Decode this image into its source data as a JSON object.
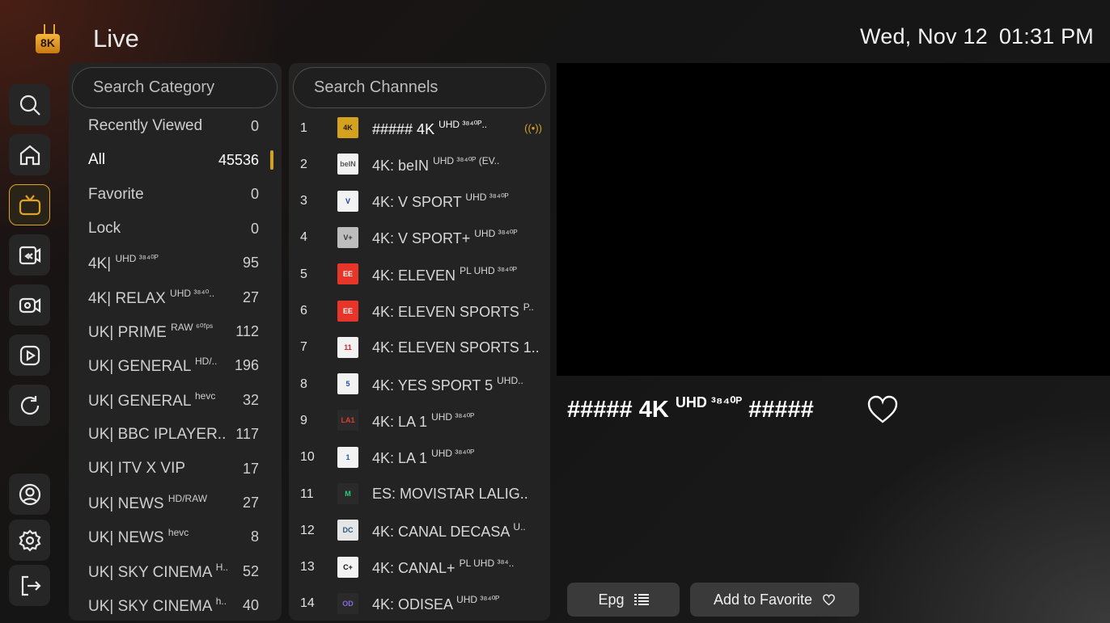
{
  "header": {
    "logo_text": "8K",
    "page_title": "Live",
    "date": "Wed, Nov 12",
    "time": "01:31 PM"
  },
  "rail": [
    {
      "icon": "search-icon"
    },
    {
      "icon": "home-icon"
    },
    {
      "icon": "tv-icon",
      "active": true
    },
    {
      "icon": "catchup-icon"
    },
    {
      "icon": "movies-icon"
    },
    {
      "icon": "series-icon"
    },
    {
      "icon": "refresh-icon"
    },
    {
      "icon": "account-icon"
    },
    {
      "icon": "settings-icon"
    },
    {
      "icon": "logout-icon"
    }
  ],
  "categories": {
    "search_placeholder": "Search Category",
    "items": [
      {
        "label": "Recently Viewed",
        "count": "0"
      },
      {
        "label": "All",
        "count": "45536",
        "selected": true
      },
      {
        "label": "Favorite",
        "count": "0"
      },
      {
        "label": "Lock",
        "count": "0"
      },
      {
        "label": "4K|",
        "sup": "UHD ³⁸⁴⁰ᴾ",
        "count": "95"
      },
      {
        "label": "4K| RELAX",
        "sup": "UHD ³⁸⁴⁰..",
        "count": "27"
      },
      {
        "label": "UK| PRIME",
        "sup": "RAW ⁶⁰ᶠᵖˢ",
        "count": "112"
      },
      {
        "label": "UK| GENERAL",
        "sup": "HD/..",
        "count": "196"
      },
      {
        "label": "UK| GENERAL",
        "sup": "hevc",
        "count": "32"
      },
      {
        "label": "UK| BBC IPLAYER..",
        "sup": "",
        "count": "117"
      },
      {
        "label": "UK| ITV X VIP",
        "sup": "",
        "count": "17"
      },
      {
        "label": "UK| NEWS",
        "sup": "HD/RAW",
        "count": "27"
      },
      {
        "label": "UK| NEWS",
        "sup": "hevc",
        "count": "8"
      },
      {
        "label": "UK| SKY CINEMA",
        "sup": "H..",
        "count": "52"
      },
      {
        "label": "UK| SKY CINEMA",
        "sup": "h..",
        "count": "40"
      }
    ]
  },
  "channels": {
    "search_placeholder": "Search Channels",
    "items": [
      {
        "num": "1",
        "name": "##### 4K",
        "sup": "UHD ³⁸⁴⁰ᴾ..",
        "logo": "4K",
        "playing": true
      },
      {
        "num": "2",
        "name": "4K: beIN",
        "sup": "UHD ³⁸⁴⁰ᴾ (EV..",
        "logo": "beIN"
      },
      {
        "num": "3",
        "name": "4K: V SPORT",
        "sup": "UHD ³⁸⁴⁰ᴾ",
        "logo": "V"
      },
      {
        "num": "4",
        "name": "4K: V SPORT+",
        "sup": "UHD ³⁸⁴⁰ᴾ",
        "logo": "V+"
      },
      {
        "num": "5",
        "name": "4K: ELEVEN",
        "sup": "PL UHD ³⁸⁴⁰ᴾ",
        "logo": "EE"
      },
      {
        "num": "6",
        "name": "4K: ELEVEN SPORTS",
        "sup": "P..",
        "logo": "EE"
      },
      {
        "num": "7",
        "name": "4K: ELEVEN SPORTS 1..",
        "sup": "",
        "logo": "11"
      },
      {
        "num": "8",
        "name": "4K: YES SPORT 5",
        "sup": "UHD..",
        "logo": "5"
      },
      {
        "num": "9",
        "name": "4K: LA 1",
        "sup": "UHD ³⁸⁴⁰ᴾ",
        "logo": "LA1"
      },
      {
        "num": "10",
        "name": "4K: LA 1",
        "sup": "UHD ³⁸⁴⁰ᴾ",
        "logo": "1"
      },
      {
        "num": "11",
        "name": "ES: MOVISTAR  LALIG..",
        "sup": "",
        "logo": "M"
      },
      {
        "num": "12",
        "name": "4K: CANAL DECASA",
        "sup": "U..",
        "logo": "DC"
      },
      {
        "num": "13",
        "name": "4K: CANAL+",
        "sup": "PL UHD ³⁸⁴..",
        "logo": "C+"
      },
      {
        "num": "14",
        "name": "4K: ODISEA",
        "sup": "UHD ³⁸⁴⁰ᴾ",
        "logo": "OD"
      }
    ]
  },
  "now_playing": {
    "title_prefix": "##### 4K",
    "title_sup": "UHD ³⁸⁴⁰ᴾ",
    "title_suffix": "#####"
  },
  "actions": {
    "epg_label": "Epg",
    "favorite_label": "Add to Favorite"
  },
  "colors": {
    "accent": "#d6a024",
    "panel": "#232323"
  }
}
